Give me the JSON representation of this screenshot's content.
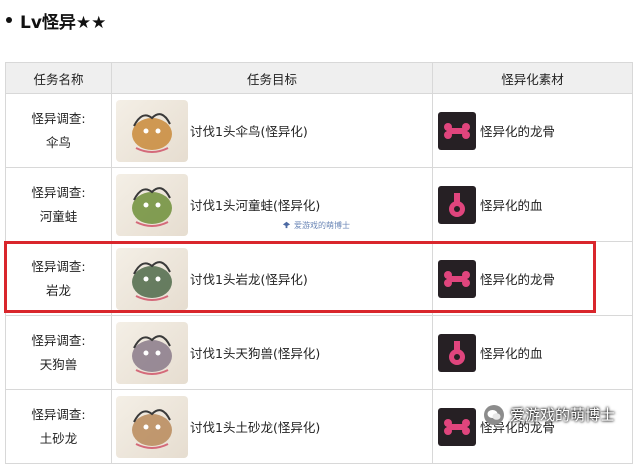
{
  "heading": {
    "title": "Lv怪异★★"
  },
  "table": {
    "headers": [
      "任务名称",
      "任务目标",
      "怪异化素材"
    ],
    "rows": [
      {
        "quest": "怪异调查:",
        "monster": "伞鸟",
        "target": "讨伐1头伞鸟(怪异化)",
        "material": "怪异化的龙骨",
        "material_icon": "bone-icon",
        "monster_color": "#c98a3a"
      },
      {
        "quest": "怪异调查:",
        "monster": "河童蛙",
        "target": "讨伐1头河童蛙(怪异化)",
        "material": "怪异化的血",
        "material_icon": "blood-flask-icon",
        "monster_color": "#6f8f3a"
      },
      {
        "quest": "怪异调查:",
        "monster": "岩龙",
        "target": "讨伐1头岩龙(怪异化)",
        "material": "怪异化的龙骨",
        "material_icon": "bone-icon",
        "monster_color": "#4f6a4a"
      },
      {
        "quest": "怪异调查:",
        "monster": "天狗兽",
        "target": "讨伐1头天狗兽(怪异化)",
        "material": "怪异化的血",
        "material_icon": "blood-flask-icon",
        "monster_color": "#8a7a8a"
      },
      {
        "quest": "怪异调查:",
        "monster": "土砂龙",
        "target": "讨伐1头土砂龙(怪异化)",
        "material": "怪异化的龙骨",
        "material_icon": "bone-icon",
        "monster_color": "#b88a5a"
      }
    ]
  },
  "watermark": {
    "text": "爱游戏的萌博士"
  },
  "wechat_badge": {
    "text": "爱游戏的萌博士"
  },
  "colors": {
    "highlight": "#d9262c",
    "material_pink": "#e0457d"
  }
}
